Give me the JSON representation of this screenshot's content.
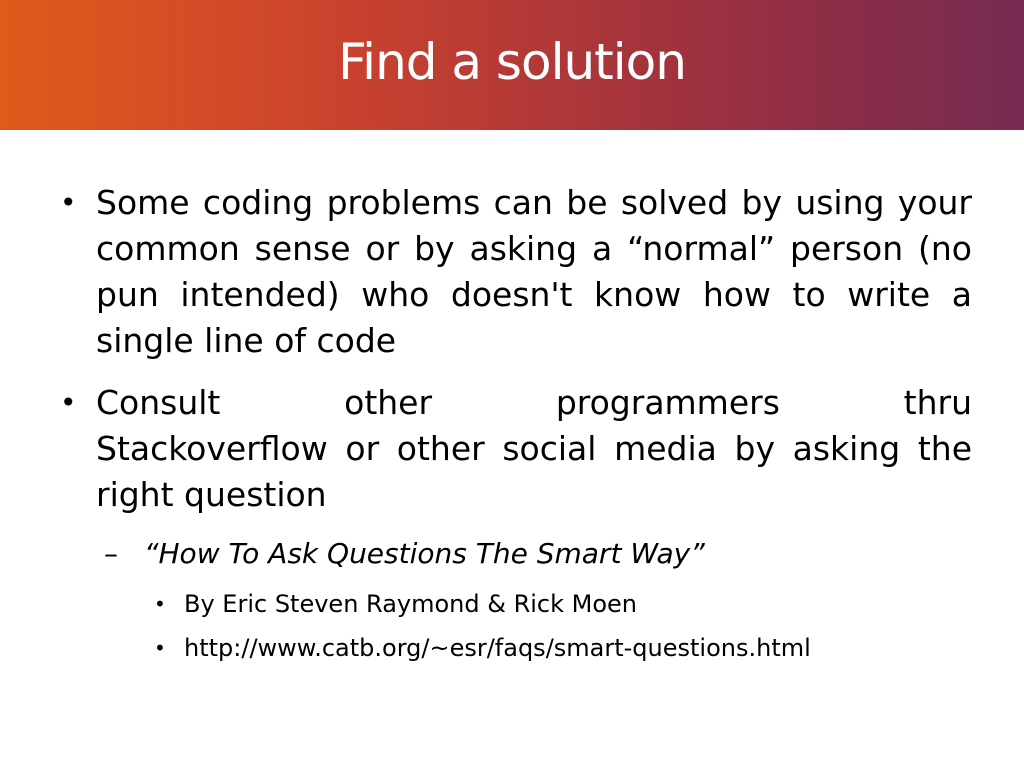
{
  "slide": {
    "title": "Find a solution",
    "bullets": [
      {
        "marker": "•",
        "text": "Some coding problems can be solved by using your common sense or by asking a “normal” person (no pun intended) who doesn't know how to write a single line of code"
      },
      {
        "marker": "•",
        "text_line1": "Consult other programmers thru",
        "text_rest": "Stackoverflow or other social media by asking the right question",
        "sub": {
          "marker": "–",
          "text": "“How To Ask Questions The Smart Way”",
          "items": [
            {
              "marker": "•",
              "text": "By Eric Steven Raymond & Rick Moen"
            },
            {
              "marker": "•",
              "text": "http://www.catb.org/~esr/faqs/smart-questions.html"
            }
          ]
        }
      }
    ]
  },
  "colors": {
    "title_gradient_start": "#e05a1c",
    "title_gradient_end": "#752a52",
    "title_text": "#ffffff",
    "body_text": "#000000"
  }
}
